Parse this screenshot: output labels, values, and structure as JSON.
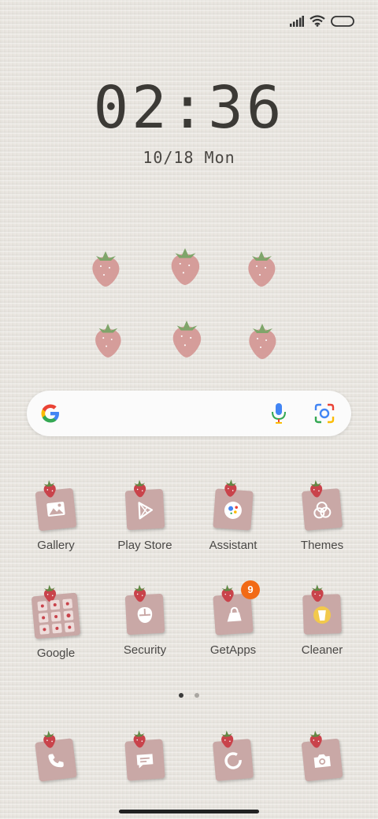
{
  "lockscreen": {
    "time": "02:36",
    "date": "10/18 Mon"
  },
  "status_bar": {
    "signal": "signal-icon",
    "wifi": "wifi-icon",
    "battery": "battery-icon"
  },
  "search_bar": {
    "logo": "google-g-icon",
    "voice": "mic-icon",
    "lens": "lens-icon"
  },
  "apps_row1": [
    {
      "label": "Gallery",
      "icon": "gallery-icon"
    },
    {
      "label": "Play Store",
      "icon": "play-store-icon"
    },
    {
      "label": "Assistant",
      "icon": "assistant-icon"
    },
    {
      "label": "Themes",
      "icon": "themes-icon"
    }
  ],
  "apps_row2": [
    {
      "label": "Google",
      "icon": "google-folder-icon"
    },
    {
      "label": "Security",
      "icon": "security-icon"
    },
    {
      "label": "GetApps",
      "icon": "getapps-icon",
      "badge": "9"
    },
    {
      "label": "Cleaner",
      "icon": "cleaner-icon"
    }
  ],
  "dock": [
    {
      "icon": "phone-icon"
    },
    {
      "icon": "messages-icon"
    },
    {
      "icon": "browser-icon"
    },
    {
      "icon": "camera-icon"
    }
  ],
  "pager": {
    "pages": 2,
    "active": 1
  },
  "colors": {
    "note": "#c9a8a6",
    "berry": "#c9434b",
    "badge": "#f26a16"
  }
}
